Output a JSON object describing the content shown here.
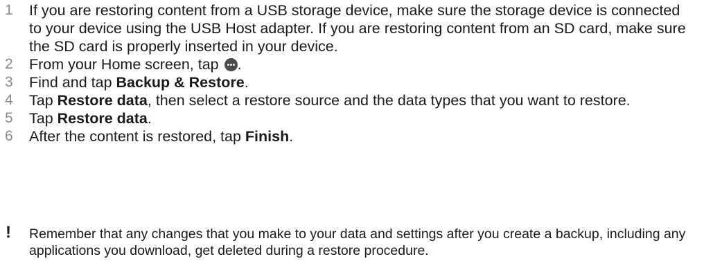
{
  "steps": [
    {
      "number": "1",
      "text": "If you are restoring content from a USB storage device, make sure the storage device is connected to your device using the USB Host adapter. If you are restoring content from an SD card, make sure the SD card is properly inserted in your device."
    },
    {
      "number": "2",
      "before": "From your Home screen, tap ",
      "icon": "apps-icon",
      "after": "."
    },
    {
      "number": "3",
      "before": "Find and tap ",
      "bold": "Backup & Restore",
      "after": "."
    },
    {
      "number": "4",
      "before": "Tap ",
      "bold": "Restore data",
      "after": ", then select a restore source and the data types that you want to restore."
    },
    {
      "number": "5",
      "before": "Tap ",
      "bold": "Restore data",
      "after": "."
    },
    {
      "number": "6",
      "before": "After the content is restored, tap ",
      "bold": "Finish",
      "after": "."
    }
  ],
  "note": {
    "icon": "exclamation-icon",
    "symbol": "!",
    "text": "Remember that any changes that you make to your data and settings after you create a backup, including any applications you download, get deleted during a restore procedure."
  }
}
